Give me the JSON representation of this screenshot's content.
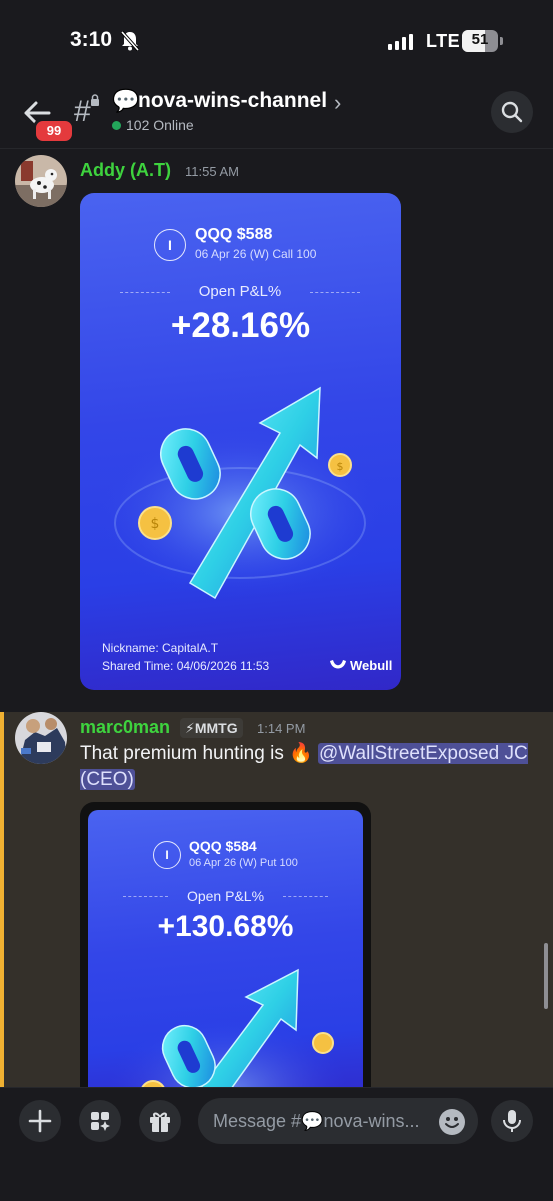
{
  "status_bar": {
    "time": "3:10",
    "network": "LTE",
    "battery": "51"
  },
  "header": {
    "unread_badge": "99",
    "channel_emoji": "💬",
    "channel_name": "nova-wins-channel",
    "online": "102 Online"
  },
  "messages": [
    {
      "author": "Addy (A.T)",
      "timestamp": "11:55 AM",
      "card": {
        "ticker_letter": "I",
        "ticker": "QQQ $588",
        "contract": "06 Apr 26 (W) Call 100",
        "pl_label": "Open P&L%",
        "pl_value": "+28.16%",
        "nickname": "Nickname: CapitalA.T",
        "shared_time": "Shared Time: 04/06/2026 11:53",
        "brand": "Webull"
      }
    },
    {
      "author": "marc0man",
      "role": "⚡MMTG",
      "timestamp": "1:14 PM",
      "text": "That premium hunting is 🔥",
      "mention": "@WallStreetExposed JC (CEO)",
      "card": {
        "ticker_letter": "I",
        "ticker": "QQQ $584",
        "contract": "06 Apr 26 (W) Put 100",
        "pl_label": "Open P&L%",
        "pl_value": "+130.68%"
      }
    }
  ],
  "composer": {
    "placeholder": "Message #💬nova-wins..."
  },
  "colors": {
    "author": "#3ed33e",
    "accent_bar": "#f0b132",
    "badge": "#e43a3d",
    "online": "#23a55a",
    "card_blue": "#3346e8"
  }
}
